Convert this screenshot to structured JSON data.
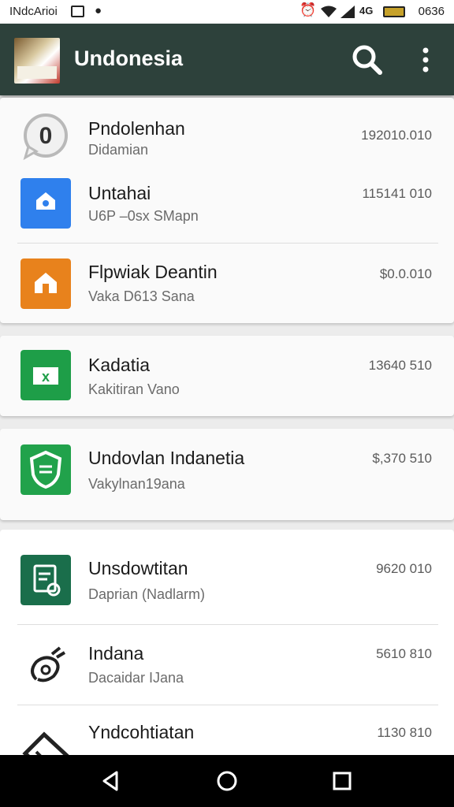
{
  "status_bar": {
    "left_text": "INdcArioi",
    "time": "0636",
    "battery_level": "0.8",
    "icons": [
      "square-icon",
      "cat-icon",
      "alarm-icon",
      "wifi-icon",
      "signal-icon",
      "data-badge-icon",
      "battery-icon"
    ]
  },
  "app_bar": {
    "title": "Undonesia",
    "logo_icon": "app-logo-icon",
    "search_icon": "search-icon",
    "more_icon": "more-vert-icon",
    "color": "#2d413b"
  },
  "items": [
    {
      "title": "Pndolenhan",
      "subtitle": "Didamian",
      "amount": "192010.010",
      "icon": "chat-zero-icon",
      "color": "#9e9e9e"
    },
    {
      "title": "Untahai",
      "subtitle": "U6P –0sx SMapn",
      "amount": "115141 010",
      "icon": "home-blue-icon",
      "color": "#2f80ed"
    },
    {
      "title": "Flpwiak Deantin",
      "subtitle": "Vaka D613 Sana",
      "amount": "$0.0.010",
      "icon": "home-orange-icon",
      "color": "#e8821c"
    },
    {
      "title": "Kadatia",
      "subtitle": "Kakitiran Vano",
      "amount": "13640 510",
      "icon": "sheet-icon",
      "color": "#1e9e48"
    },
    {
      "title": "Undovlan Indanetia",
      "subtitle": "Vakylnan19ana",
      "amount": "$,370 510",
      "icon": "shield-icon",
      "color": "#21a24b"
    },
    {
      "title": "Unsdowtitan",
      "subtitle": "Daprian (Nadlarm)",
      "amount": "9620 010",
      "icon": "document-icon",
      "color": "#1a6e4b"
    },
    {
      "title": "Indana",
      "subtitle": "Dacaidar IJana",
      "amount": "5610 810",
      "icon": "scribble-icon",
      "color": "#222222"
    },
    {
      "title": "Yndcohtiatan",
      "subtitle": "",
      "amount": "1130 810",
      "icon": "tag-icon",
      "color": "#222222"
    }
  ],
  "nav_bar": {
    "back_icon": "back-icon",
    "home_icon": "home-icon",
    "recents_icon": "recents-icon"
  }
}
